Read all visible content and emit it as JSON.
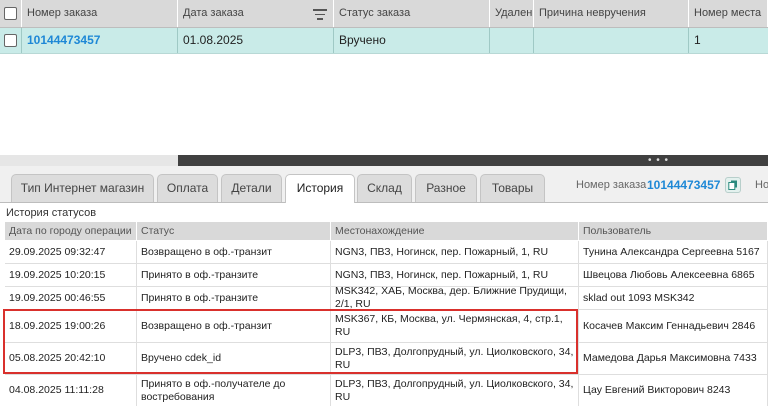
{
  "orders_grid": {
    "headers": [
      "Номер заказа",
      "Дата заказа",
      "Статус заказа",
      "Удален",
      "Причина невручения",
      "Номер места"
    ],
    "row": {
      "order_number": "10144473457",
      "order_date": "01.08.2025",
      "status": "Вручено",
      "deleted": "",
      "reason": "",
      "place_number": "1"
    },
    "selected_row_color": "#c9ebe8"
  },
  "tabs": [
    "Тип Интернет магазин",
    "Оплата",
    "Детали",
    "История",
    "Склад",
    "Разное",
    "Товары"
  ],
  "active_tab": "История",
  "order_info": {
    "label": "Номер заказа",
    "number": "10144473457",
    "cut_label": "Но"
  },
  "history": {
    "title": "История статусов",
    "headers": [
      "Дата по городу операции",
      "Статус",
      "Местонахождение",
      "Пользователь"
    ],
    "rows": [
      {
        "date": "29.09.2025 09:32:47",
        "status": "Возвращено в оф.-транзит",
        "location": "NGN3, ПВЗ, Ногинск, пер. Пожарный, 1, RU",
        "user": "Тунина Александра Сергеевна 5167"
      },
      {
        "date": "19.09.2025 10:20:15",
        "status": "Принято в оф.-транзите",
        "location": "NGN3, ПВЗ, Ногинск, пер. Пожарный, 1, RU",
        "user": "Швецова Любовь Алексеевна 6865"
      },
      {
        "date": "19.09.2025 00:46:55",
        "status": "Принято в оф.-транзите",
        "location": "MSK342, ХАБ, Москва, дер. Ближние Прудищи, 2/1, RU",
        "user": "sklad out 1093 MSK342"
      },
      {
        "date": "18.09.2025 19:00:26",
        "status": "Возвращено в оф.-транзит",
        "location": "MSK367, КБ, Москва, ул. Чермянская, 4, стр.1, RU",
        "user": "Косачев Максим Геннадьевич 2846"
      },
      {
        "date": "05.08.2025 20:42:10",
        "status": "Вручено cdek_id",
        "location": "DLP3, ПВЗ, Долгопрудный, ул. Циолковского, 34, RU",
        "user": "Мамедова Дарья Максимовна 7433"
      },
      {
        "date": "04.08.2025 11:11:28",
        "status": "Принято в оф.-получателе до востребования",
        "location": "DLP3, ПВЗ, Долгопрудный, ул. Циолковского, 34, RU",
        "user": "Цау Евгений Викторович 8243"
      }
    ],
    "highlight_color": "#d9302c"
  },
  "colors": {
    "link": "#1e88d6",
    "header_bg": "#d9d9d9"
  }
}
